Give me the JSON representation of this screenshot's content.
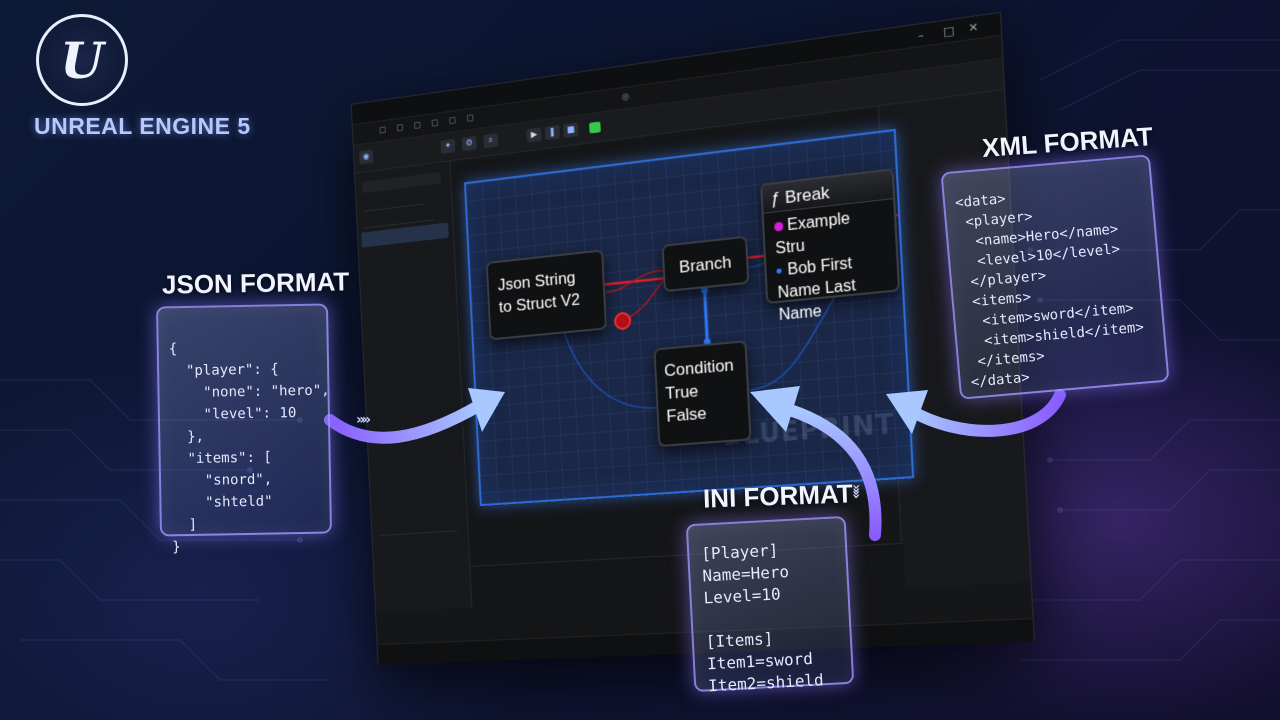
{
  "logo": {
    "mark_letter": "U",
    "text": "UNREAL ENGINE 5"
  },
  "graph": {
    "node_json": {
      "line1": "Json String",
      "line2": "to Struct V2"
    },
    "node_branch": {
      "title": "Branch"
    },
    "node_break": {
      "title": "Break",
      "pin1": "Example Stru",
      "pin2": "Bob First",
      "pin3": "Name Last Name"
    },
    "node_condition": {
      "line1": "Condition",
      "line2": "True",
      "line3": "False"
    }
  },
  "cards": {
    "json": {
      "title": "JSON FORMAT",
      "lines": [
        "{",
        "  \"player\": {",
        "    \"none\": \"hero\",",
        "    \"level\": 10",
        "  },",
        "  \"items\": [",
        "    \"snord\",",
        "    \"shteld\"",
        "  ]",
        "}"
      ]
    },
    "xml": {
      "title": "XML FORMAT",
      "lines": [
        "<data>",
        " <player>",
        "  <name>Hero</name>",
        "  <level>10</level>",
        " </player>",
        " <items>",
        "  <item>sword</item>",
        "  <item>shield</item>",
        " </items>",
        "</data>"
      ]
    },
    "ini": {
      "title": "INI FORMAT",
      "lines": [
        "[Player]",
        "Name=Hero",
        "Level=10",
        "",
        "[Items]",
        "Item1=sword",
        "Item2=shield"
      ]
    }
  },
  "colors": {
    "accent_blue": "#2f6bd6",
    "card_border": "#a096ff",
    "exec_wire": "#e0202c",
    "struct_pin": "#d21fd8",
    "arrow_light": "#a8c8ff",
    "arrow_purple": "#8a5cff"
  }
}
